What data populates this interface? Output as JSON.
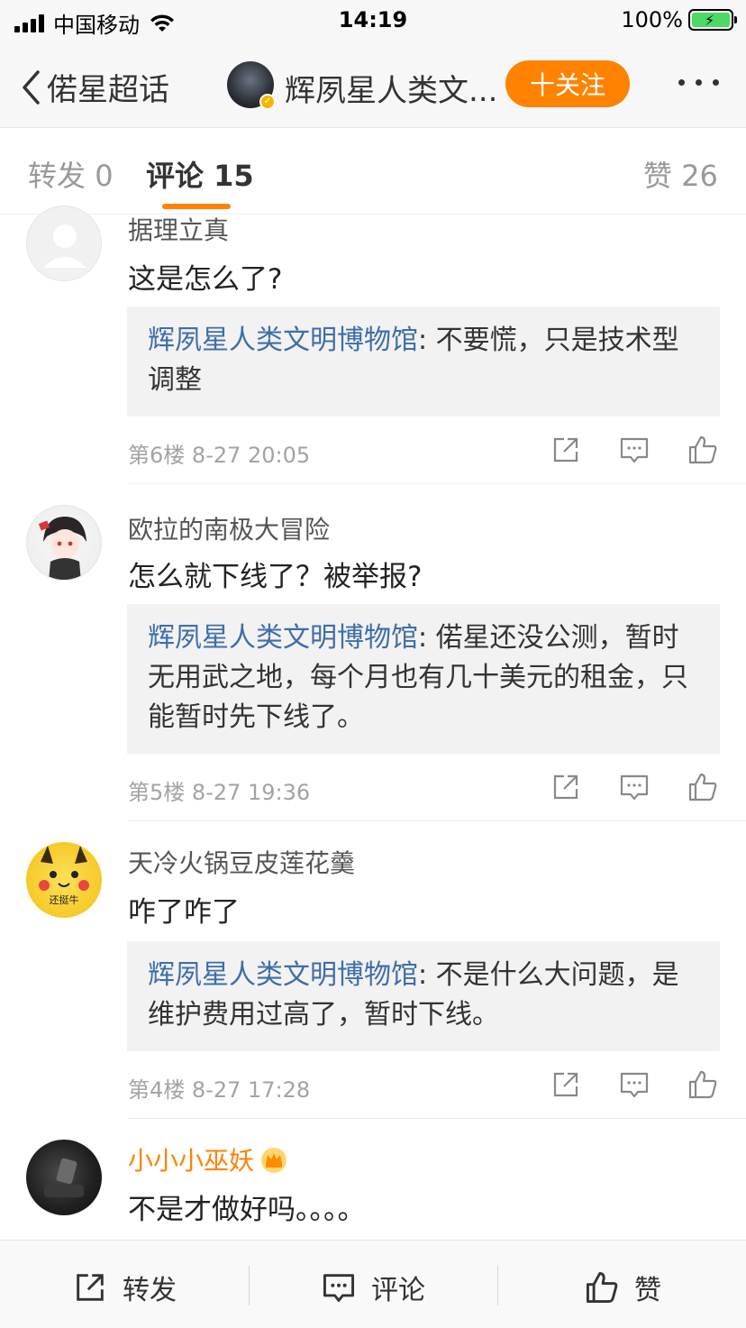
{
  "status_bar": {
    "carrier": "中国移动",
    "time": "14:19",
    "battery": "100%",
    "battery_level": 1.0,
    "wifi_icon": "wifi-icon",
    "signal_icon": "signal-bars-icon"
  },
  "nav": {
    "back_label": "偌星超话",
    "title": "辉夙星人类文...",
    "follow_label": "十关注",
    "verified_icon": "verified-badge-icon"
  },
  "tabs": [
    {
      "label": "转发",
      "count": "0"
    },
    {
      "label": "评论",
      "count": "15"
    },
    {
      "label": "赞",
      "count": "26"
    }
  ],
  "comments": [
    {
      "username": "据理立真",
      "text": "这是怎么了?",
      "reply_author": "辉夙星人类文明博物馆",
      "reply_text": ": 不要慌，只是技术型调整",
      "floor": "第6楼",
      "time": "8-27 20:05"
    },
    {
      "username": "欧拉的南极大冒险",
      "text": "怎么就下线了？被举报?",
      "reply_author": "辉夙星人类文明博物馆",
      "reply_text": ": 偌星还没公测，暂时无用武之地，每个月也有几十美元的租金，只能暂时先下线了。",
      "floor": "第5楼",
      "time": "8-27 19:36"
    },
    {
      "username": "天冷火锅豆皮莲花羹",
      "text": "咋了咋了",
      "avatar_text": "还挺牛",
      "reply_author": "辉夙星人类文明博物馆",
      "reply_text": ": 不是什么大问题，是维护费用过高了，暂时下线。",
      "floor": "第4楼",
      "time": "8-27 17:28"
    },
    {
      "username": "小小小巫妖",
      "text": "不是才做好吗。。。。",
      "badge_icon": "vip-crown-icon"
    }
  ],
  "bottom_bar": {
    "repost_label": "转发",
    "comment_label": "评论",
    "like_label": "赞"
  },
  "colors": {
    "accent": "#ff8200",
    "link": "#3f6ea8",
    "reply_bg": "#f2f2f2"
  }
}
